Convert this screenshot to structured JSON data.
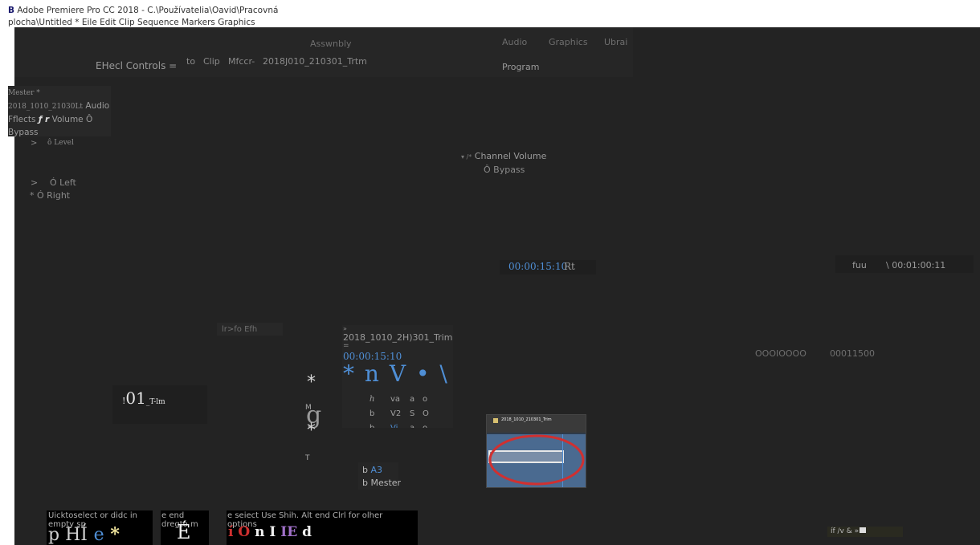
{
  "window": {
    "title_line1": "Adobe Premiere Pro CC 2018 - C.\\Používatelia\\Oavid\\Pracovná",
    "title_line2": "plocha\\Untitled * Eile Edit Clip Sequence Markers Graphics",
    "logo_letter": "B"
  },
  "header": {
    "assembly_tab": "Asswnbly",
    "audio_tab": "Audio",
    "graphics_tab": "Graphics",
    "library_tab": "Ubrai",
    "program_label": "Program",
    "effect_controls": "EHecl Controls =",
    "to_label": "to",
    "clip_label": "Clip",
    "mixer_label": "Mfccr-",
    "clip_name": "2018J010_210301_Trtm"
  },
  "effects_panel": {
    "master": "Mester *",
    "clip_audio_id": "2018_1010_21030Lt",
    "clip_audio_label": "Audio",
    "effects_line": "Fflects",
    "fx_symbol": "ƒ r",
    "volume": "Volume Ô",
    "bypass": "Bypass",
    "level_arrow": ">",
    "level": "ô Level",
    "left_arrow": ">",
    "left": "Ó Left",
    "right": "* Ó Right",
    "channel_volume_prefix": "▾ /*",
    "channel_volume": "Channel Volume",
    "channel_bypass": "Ô Bypass"
  },
  "program_monitor": {
    "timecode": "00:00:15:10",
    "rt": "Rt",
    "fuu": "fuu",
    "duration": "\\ 00:01:00:11",
    "counter_a": "OOOIOOOO",
    "counter_b": "00011500"
  },
  "timeline": {
    "info_label": "lr>fo Efh",
    "seq_marker": "»",
    "seq_name": "2018_1010_2H)301_Trim",
    "eq": "=",
    "seq_timecode": "00:00:15:10",
    "icon_row": "* n V • \\",
    "track_rows": [
      [
        "h",
        "va",
        "a",
        "o"
      ],
      [
        "b",
        "V2",
        "S",
        "O"
      ],
      [
        "b",
        "Vi",
        "a",
        "o"
      ]
    ],
    "track_a3_prefix": "b",
    "track_a3": "A3",
    "track_master": "b Mester",
    "left_timecode_prefix": "!",
    "left_timecode_big": "01",
    "left_timecode_suffix": "_T-lm"
  },
  "tools": {
    "star1": "*",
    "m_label": "M",
    "glyph": "g",
    "star2": "*",
    "t_label": "T"
  },
  "thumbnail": {
    "caption": "2018_1010_210301_Trim"
  },
  "hints": {
    "hint1_line1": "Uicktoselect or didc in",
    "hint1_line2": "empty sp",
    "hint1_glyphs": "p HÍ",
    "hint1_blue": "e",
    "hint1_star": "*",
    "hint2_line1": "e end",
    "hint2_line2": "dregto m",
    "hint2_glyph": "É",
    "hint3_line1": "e seiect Use Shih. Alt end Clrl for olher",
    "hint3_line2": "options",
    "hint3_red": "í O",
    "hint3_white": "n I",
    "hint3_purple": "IE",
    "hint3_end": "d"
  },
  "status": {
    "text": "íf /v & »"
  }
}
